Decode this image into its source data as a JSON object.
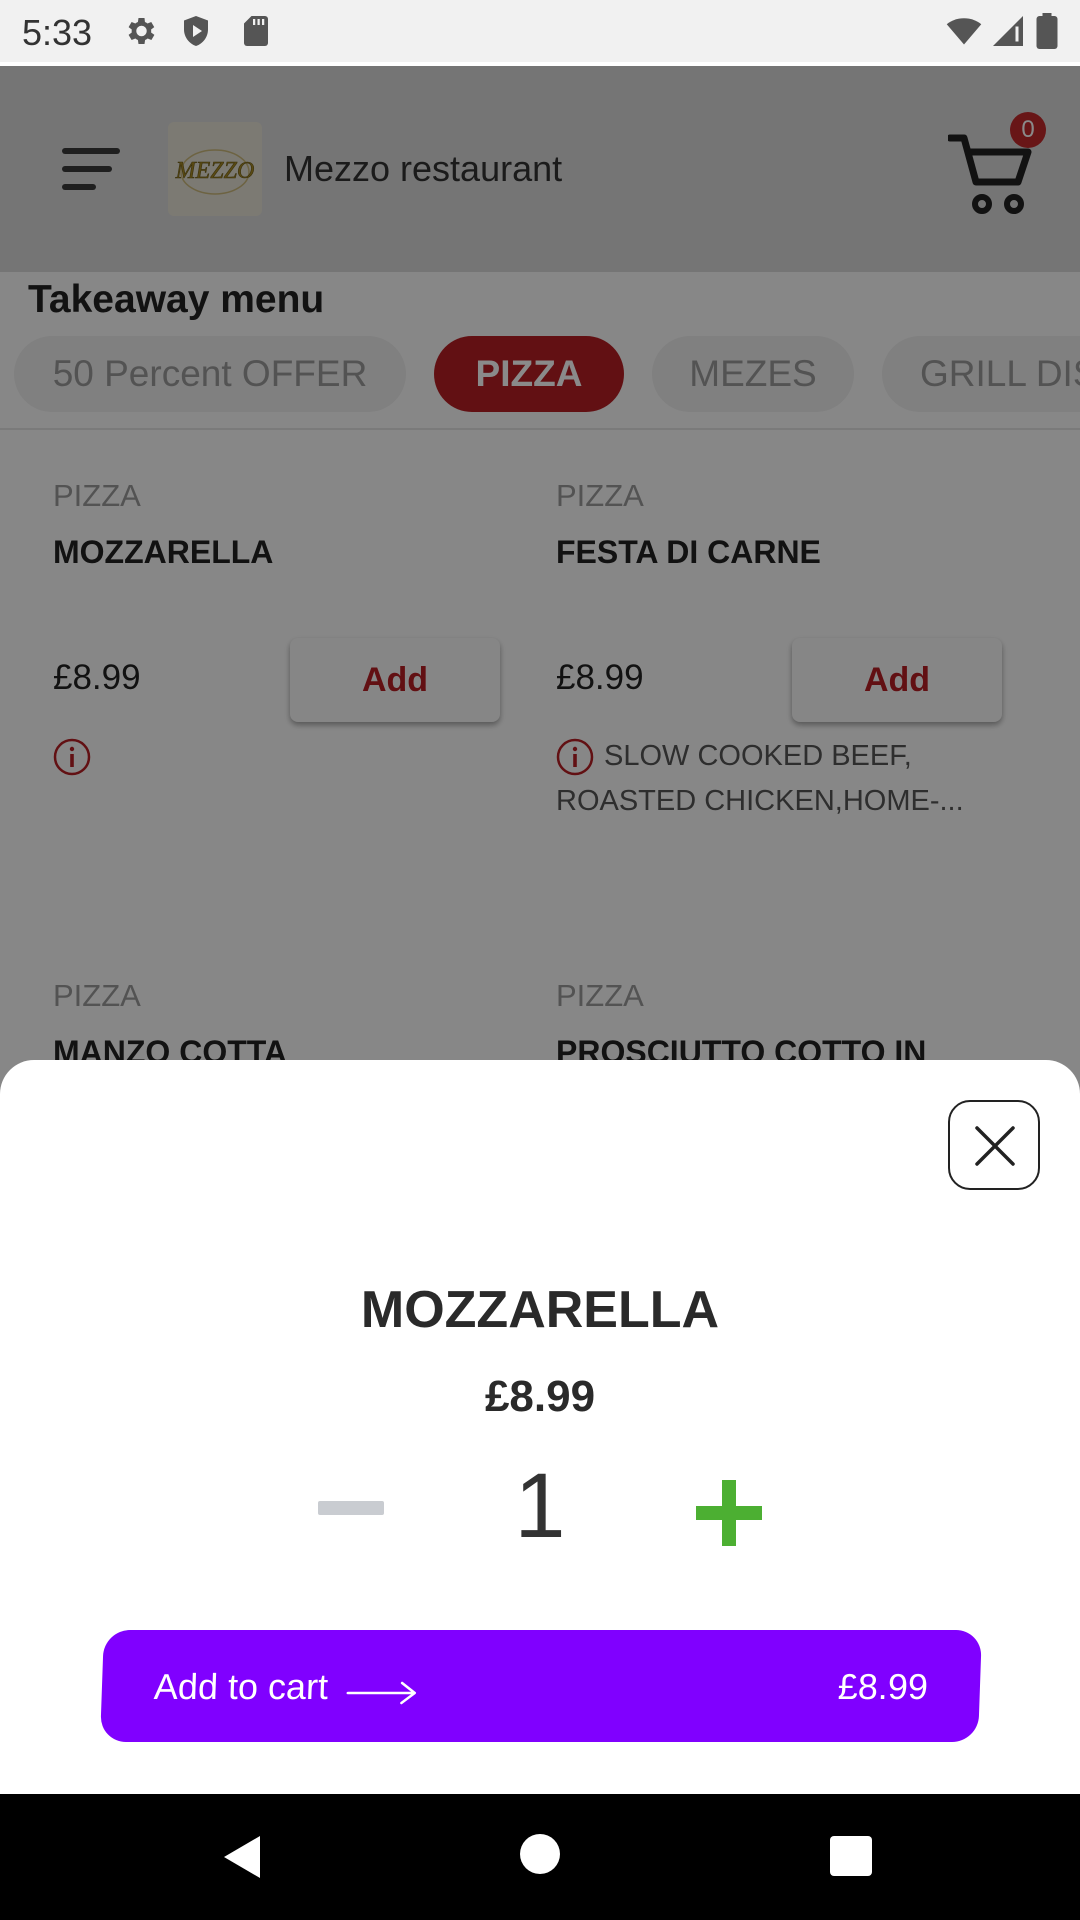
{
  "status_bar": {
    "time": "5:33"
  },
  "header": {
    "restaurant_name": "Mezzo restaurant",
    "logo_text": "MEZZO",
    "cart_count": "0"
  },
  "menu": {
    "title": "Takeaway menu",
    "categories": [
      "50 Percent OFFER",
      "PIZZA",
      "MEZES",
      "GRILL DIS"
    ],
    "active_category": "PIZZA",
    "items": [
      {
        "category": "PIZZA",
        "name": "MOZZARELLA",
        "price": "£8.99",
        "add_label": "Add",
        "description": ""
      },
      {
        "category": "PIZZA",
        "name": "FESTA DI CARNE",
        "price": "£8.99",
        "add_label": "Add",
        "description": "SLOW COOKED BEEF, ROASTED CHICKEN,HOME-..."
      },
      {
        "category": "PIZZA",
        "name": "MANZO COTTA"
      },
      {
        "category": "PIZZA",
        "name": "PROSCIUTTO COTTO IN"
      }
    ]
  },
  "sheet": {
    "title": "MOZZARELLA",
    "price": "£8.99",
    "quantity": "1",
    "add_to_cart_label": "Add to cart",
    "total": "£8.99"
  },
  "colors": {
    "accent_red": "#b51f24",
    "primary_purple": "#8000ff",
    "plus_green": "#4caf32",
    "minus_grey": "#c9ccd1"
  },
  "icons": [
    "settings-icon",
    "shield-icon",
    "sd-card-icon",
    "wifi-icon",
    "signal-icon",
    "battery-icon",
    "hamburger-menu-icon",
    "cart-icon",
    "info-icon",
    "close-icon",
    "arrow-right-icon",
    "nav-back-icon",
    "nav-home-icon",
    "nav-recents-icon"
  ]
}
